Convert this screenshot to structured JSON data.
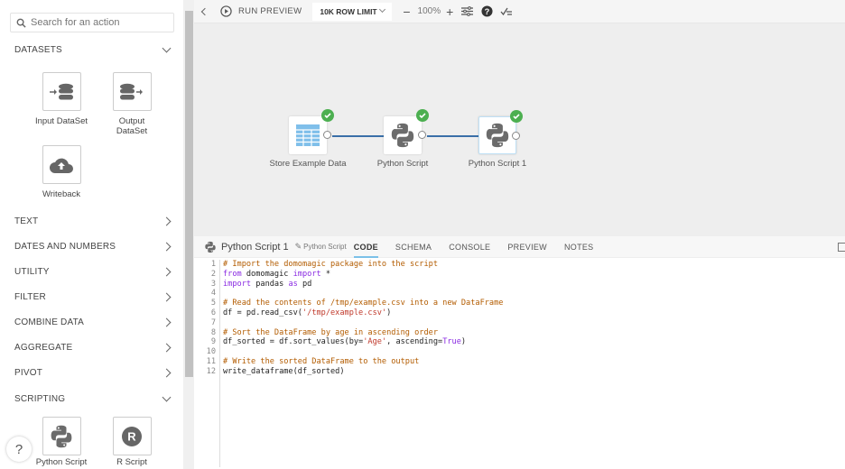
{
  "sidebar": {
    "search_placeholder": "Search for an action",
    "datasets_label": "DATASETS",
    "dataset_tiles": [
      "Input DataSet",
      "Output DataSet",
      "Writeback"
    ],
    "sections": [
      "TEXT",
      "DATES AND NUMBERS",
      "UTILITY",
      "FILTER",
      "COMBINE DATA",
      "AGGREGATE",
      "PIVOT"
    ],
    "scripting_label": "SCRIPTING",
    "scripting_tiles": [
      "Python Script",
      "R Script"
    ],
    "help": "?"
  },
  "toolbar": {
    "run_preview": "RUN PREVIEW",
    "row_limit": "10K ROW LIMIT",
    "zoom": "100%"
  },
  "canvas": {
    "nodes": [
      {
        "label": "Store Example Data",
        "status": "success"
      },
      {
        "label": "Python Script",
        "status": "success"
      },
      {
        "label": "Python Script 1",
        "status": "success"
      }
    ]
  },
  "panel": {
    "title": "Python Script 1",
    "type_label": "Python Script",
    "tabs": [
      "CODE",
      "SCHEMA",
      "CONSOLE",
      "PREVIEW",
      "NOTES"
    ],
    "active_tab": "CODE"
  },
  "code": {
    "lines": [
      "# Import the domomagic package into the script",
      "from domomagic import *",
      "import pandas as pd",
      "",
      "# Read the contents of /tmp/example.csv into a new DataFrame",
      "df = pd.read_csv('/tmp/example.csv')",
      "",
      "# Sort the DataFrame by age in ascending order",
      "df_sorted = df.sort_values(by='Age', ascending=True)",
      "",
      "# Write the sorted DataFrame to the output",
      "write_dataframe(df_sorted)"
    ]
  },
  "colors": {
    "accent": "#7cc1e8",
    "edge": "#3a6fa8",
    "success": "#4caf50",
    "comment": "#b35c00",
    "keyword": "#8a2be2",
    "string": "#c0392b"
  }
}
